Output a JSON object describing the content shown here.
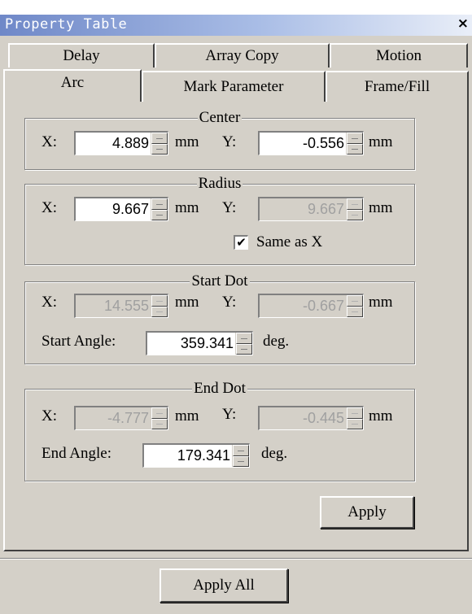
{
  "window": {
    "title": "Property Table",
    "close_label": "×"
  },
  "tabs_row1": [
    "Delay",
    "Array Copy",
    "Motion"
  ],
  "tabs_row2": [
    "Arc",
    "Mark Parameter",
    "Frame/Fill"
  ],
  "active_tab": "Arc",
  "center": {
    "legend": "Center",
    "x_label": "X:",
    "x_value": "4.889",
    "x_unit": "mm",
    "y_label": "Y:",
    "y_value": "-0.556",
    "y_unit": "mm"
  },
  "radius": {
    "legend": "Radius",
    "x_label": "X:",
    "x_value": "9.667",
    "x_unit": "mm",
    "y_label": "Y:",
    "y_value": "9.667",
    "y_unit": "mm",
    "same_as_x_label": "Same as X",
    "same_as_x_checked": true,
    "check_mark": "✔"
  },
  "start_dot": {
    "legend": "Start Dot",
    "x_label": "X:",
    "x_value": "14.555",
    "x_unit": "mm",
    "y_label": "Y:",
    "y_value": "-0.667",
    "y_unit": "mm",
    "angle_label": "Start Angle:",
    "angle_value": "359.341",
    "angle_unit": "deg."
  },
  "end_dot": {
    "legend": "End Dot",
    "x_label": "X:",
    "x_value": "-4.777",
    "x_unit": "mm",
    "y_label": "Y:",
    "y_value": "-0.445",
    "y_unit": "mm",
    "angle_label": "End Angle:",
    "angle_value": "179.341",
    "angle_unit": "deg."
  },
  "buttons": {
    "apply": "Apply",
    "apply_all": "Apply All"
  },
  "colors": {
    "face": "#d4d0c8",
    "titlebar_start": "#6f88c8",
    "titlebar_end": "#e9eef8",
    "disabled_text": "#a0a0a0"
  }
}
